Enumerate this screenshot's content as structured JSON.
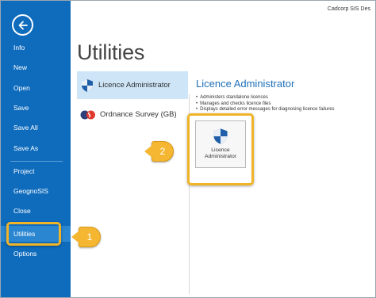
{
  "app": {
    "title": "Cadcorp SIS Des"
  },
  "sidebar": {
    "back_icon": "back-arrow-icon",
    "items": [
      {
        "label": "Info"
      },
      {
        "label": "New"
      },
      {
        "label": "Open"
      },
      {
        "label": "Save"
      },
      {
        "label": "Save All"
      },
      {
        "label": "Save As"
      },
      {
        "label": "Project"
      },
      {
        "label": "GeognoSIS"
      },
      {
        "label": "Close"
      },
      {
        "label": "Utilities",
        "selected": true
      },
      {
        "label": "Options"
      }
    ]
  },
  "main": {
    "title": "Utilities",
    "utilities": [
      {
        "label": "Licence Administrator",
        "icon": "shield-icon",
        "selected": true
      },
      {
        "label": "Ordnance Survey (GB)",
        "icon": "ordnance-survey-icon",
        "selected": false
      }
    ],
    "detail": {
      "title": "Licence Administrator",
      "bullets": [
        "Administers standalone licences",
        "Manages and checks licence files",
        "Displays detailed error messages for diagnosing licence failures"
      ],
      "button_label": "Licence Administrator",
      "button_icon": "shield-icon"
    }
  },
  "callouts": [
    {
      "label": "1"
    },
    {
      "label": "2"
    }
  ],
  "colors": {
    "sidebar": "#0f6cbd",
    "sidebar_selected": "#2a86d1",
    "accent_title": "#1e6fb8",
    "highlight": "#f0b428",
    "selected_item": "#cde5f7"
  }
}
